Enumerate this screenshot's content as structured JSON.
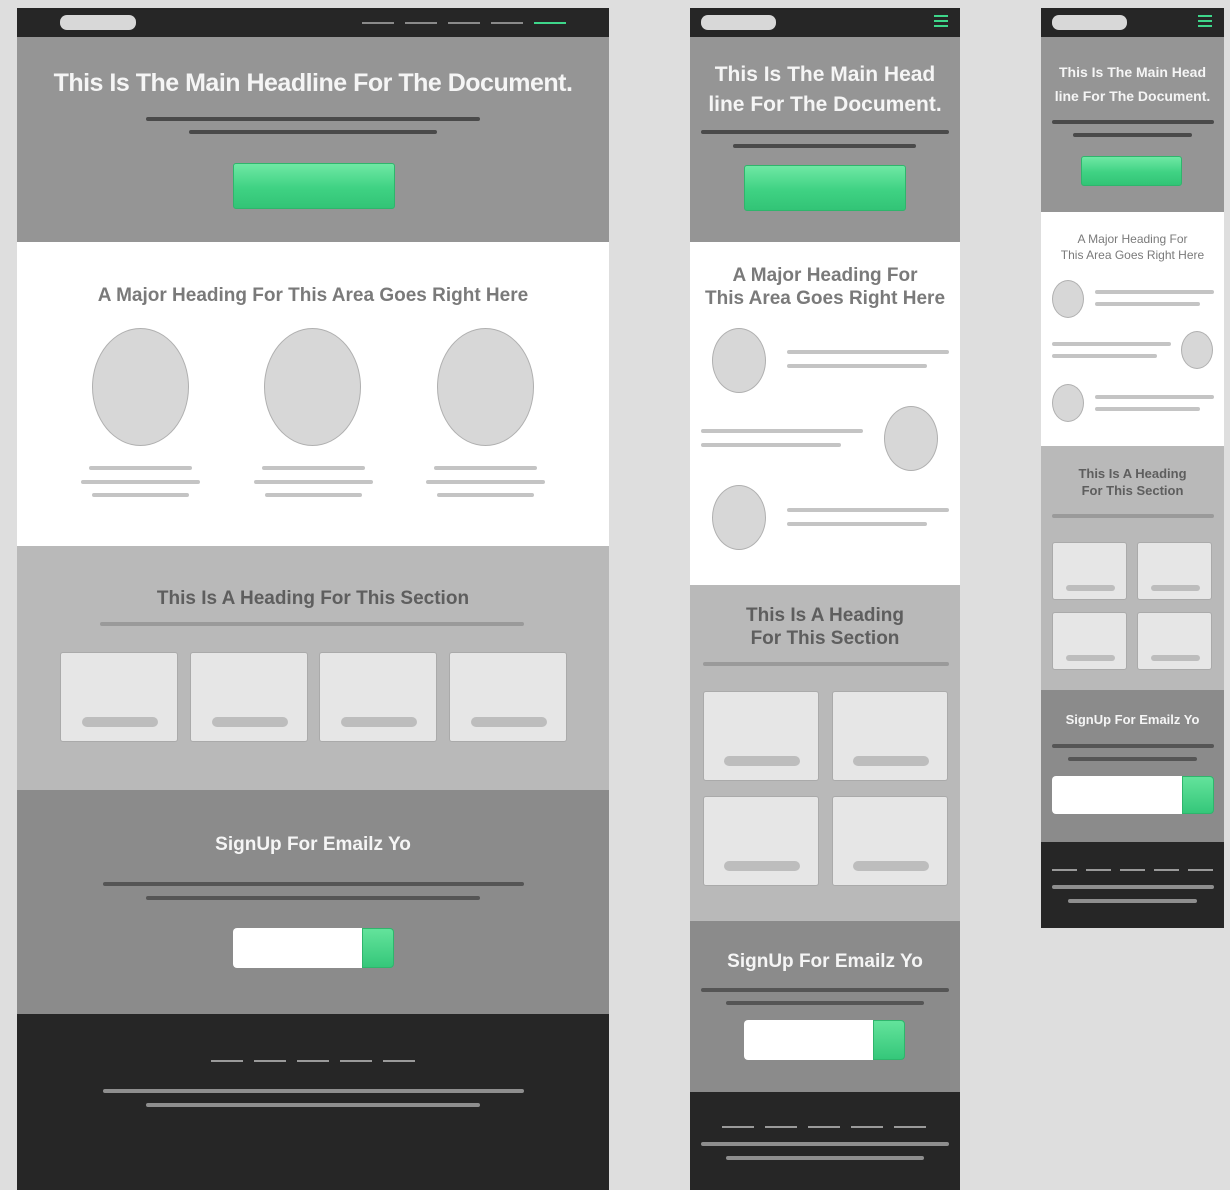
{
  "hero": {
    "headline": "This Is The Main Headline For The Document."
  },
  "hero_tablet": {
    "line1": "This Is The Main Head",
    "line2": "line For The Document."
  },
  "hero_mobile": {
    "line1": "This Is The Main Head",
    "line2": "line For The Document."
  },
  "features": {
    "heading": "A Major Heading For This Area Goes Right Here"
  },
  "features_stacked": {
    "line1": "A Major Heading For",
    "line2": "This Area Goes Right Here"
  },
  "section": {
    "heading": "This Is A Heading For This Section"
  },
  "section_stacked": {
    "line1": "This Is A Heading",
    "line2": "For This Section"
  },
  "signup": {
    "heading": "SignUp For Emailz Yo"
  },
  "colors": {
    "accent": "#3ed68a",
    "header": "#262626",
    "hero": "#959595",
    "section": "#b9b9b9",
    "signup": "#8b8b8b"
  },
  "icons": {
    "menu": "hamburger-icon"
  }
}
